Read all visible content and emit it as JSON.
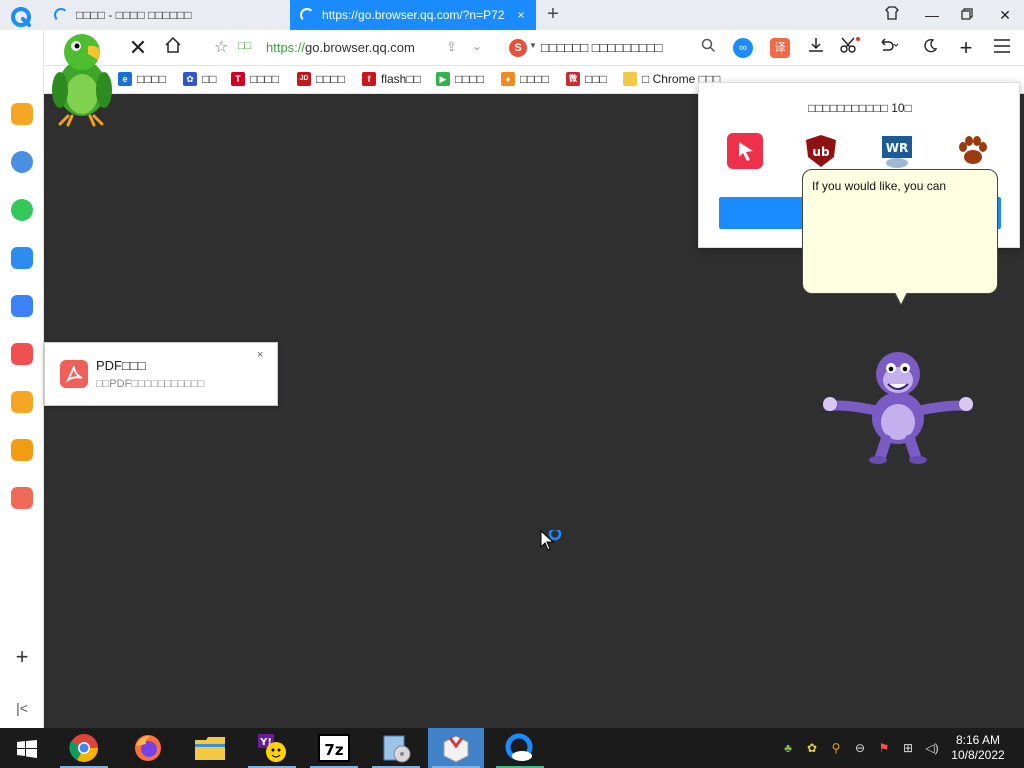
{
  "tabs": [
    {
      "label": "□□□□ - □□□□ □□□□□□",
      "close": ""
    },
    {
      "label": "https://go.browser.qq.com/?n=P72",
      "close": "×"
    }
  ],
  "toolbar": {
    "secure_label": "□□",
    "url_scheme": "https://",
    "url_host": "go.browser.qq.com",
    "search_engine_glyph": "S",
    "search_placeholder": "□□□□□□ □□□□□□□□□",
    "translate_glyph": "译"
  },
  "bookmarks": [
    {
      "label": "□□□□",
      "icon": "ie-icon",
      "color": "#1a6fd8",
      "glyph": "e"
    },
    {
      "label": "□□",
      "icon": "paw-icon",
      "color": "#3355cc",
      "glyph": "✿"
    },
    {
      "label": "□□□□",
      "icon": "tmall-icon",
      "color": "#d00020",
      "glyph": "T"
    },
    {
      "label": "□□□□",
      "icon": "jd-icon",
      "color": "#c8161d",
      "glyph": "JD"
    },
    {
      "label": "flash□□",
      "icon": "flash-icon",
      "color": "#c8161d",
      "glyph": "f"
    },
    {
      "label": "□□□□",
      "icon": "video-icon",
      "color": "#35b34a",
      "glyph": "▶"
    },
    {
      "label": "□□□□",
      "icon": "game-icon",
      "color": "#f08a24",
      "glyph": "♦"
    },
    {
      "label": "□□□",
      "icon": "weibo-icon",
      "color": "#c82c2c",
      "glyph": "微"
    },
    {
      "label": "□ Chrome □□□",
      "icon": "folder-icon",
      "color": "#f3c843",
      "glyph": ""
    }
  ],
  "ext_popup": {
    "title": "□□□□□□□□□□□ 10□",
    "button": "□□",
    "extensions": [
      {
        "name": "cursor-extension-icon",
        "color": "#f0304a"
      },
      {
        "name": "ublock-extension-icon",
        "color": "#8f1111",
        "glyph": "ub"
      },
      {
        "name": "wr-extension-icon",
        "color": "#1c5a96",
        "glyph": "WR"
      },
      {
        "name": "paw-extension-icon",
        "color": "#9b3b10"
      }
    ]
  },
  "balloon": {
    "text": "If you would like, you can"
  },
  "pdf_toast": {
    "title": "PDF□□□",
    "desc": "□□PDF□□□□□□□□□□□",
    "close": "×"
  },
  "taskbar": {
    "apps": [
      "chrome-icon",
      "firefox-icon",
      "file-explorer-icon",
      "yahoo-messenger-icon",
      "7zip-icon",
      "installer-icon",
      "package-icon",
      "qq-browser-icon"
    ],
    "time": "8:16 AM",
    "date": "10/8/2022"
  }
}
